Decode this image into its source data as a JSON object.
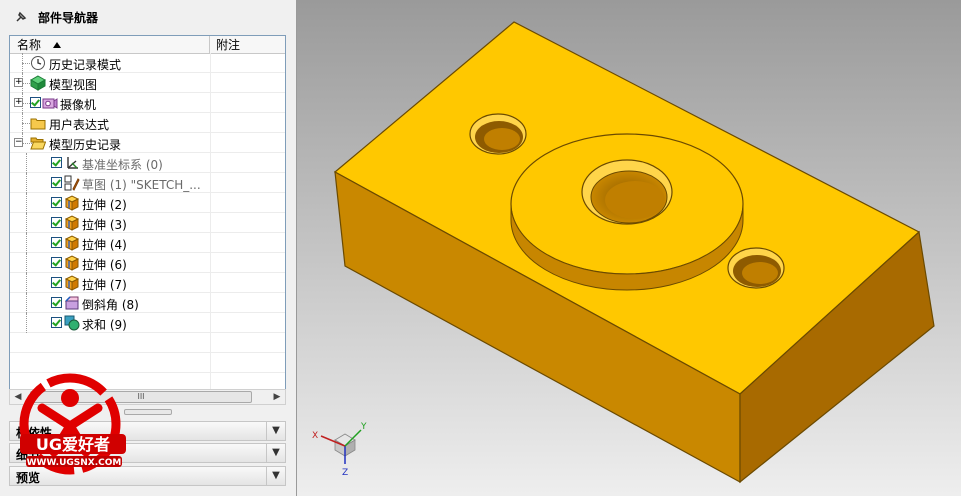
{
  "navigator": {
    "title": "部件导航器",
    "columns": {
      "name": "名称",
      "note": "附注"
    },
    "rows": [
      {
        "label": "历史记录模式",
        "icon": "clock-icon",
        "indent": 0,
        "expander": "",
        "checked": false,
        "gray": false
      },
      {
        "label": "模型视图",
        "icon": "model-views-icon",
        "indent": 0,
        "expander": "+",
        "checked": false,
        "gray": false
      },
      {
        "label": "摄像机",
        "icon": "camera-icon",
        "indent": 0,
        "expander": "+",
        "checked": true,
        "gray": false
      },
      {
        "label": "用户表达式",
        "icon": "folder-icon",
        "indent": 0,
        "expander": "",
        "checked": false,
        "gray": false
      },
      {
        "label": "模型历史记录",
        "icon": "folder-open-icon",
        "indent": 0,
        "expander": "−",
        "checked": false,
        "gray": false
      },
      {
        "label": "基准坐标系 (0)",
        "icon": "datum-csys-icon",
        "indent": 1,
        "expander": "",
        "checked": true,
        "gray": true
      },
      {
        "label": "草图 (1) \"SKETCH_...",
        "icon": "sketch-icon",
        "indent": 1,
        "expander": "",
        "checked": true,
        "gray": true
      },
      {
        "label": "拉伸 (2)",
        "icon": "extrude-icon",
        "indent": 1,
        "expander": "",
        "checked": true,
        "gray": false
      },
      {
        "label": "拉伸 (3)",
        "icon": "extrude-icon",
        "indent": 1,
        "expander": "",
        "checked": true,
        "gray": false
      },
      {
        "label": "拉伸 (4)",
        "icon": "extrude-icon",
        "indent": 1,
        "expander": "",
        "checked": true,
        "gray": false
      },
      {
        "label": "拉伸 (6)",
        "icon": "extrude-icon",
        "indent": 1,
        "expander": "",
        "checked": true,
        "gray": false
      },
      {
        "label": "拉伸 (7)",
        "icon": "extrude-icon",
        "indent": 1,
        "expander": "",
        "checked": true,
        "gray": false
      },
      {
        "label": "倒斜角 (8)",
        "icon": "chamfer-icon",
        "indent": 1,
        "expander": "",
        "checked": true,
        "gray": false
      },
      {
        "label": "求和 (9)",
        "icon": "unite-icon",
        "indent": 1,
        "expander": "",
        "checked": true,
        "gray": false
      }
    ],
    "scroll_thumb_glyph": "III",
    "panels": [
      {
        "label": "相依性"
      },
      {
        "label": "细节"
      },
      {
        "label": "预览"
      }
    ]
  },
  "watermark": {
    "brand": "UG爱好者",
    "url": "WWW.UGSNX.COM"
  },
  "triad": {
    "x": "X",
    "y": "Y",
    "z": "Z"
  },
  "colors": {
    "part_top": "#FFC800",
    "part_front": "#C98800",
    "part_side": "#A86A00",
    "viewport_bg_top": "#9a9a9a",
    "viewport_bg_bottom": "#eeeeee"
  }
}
